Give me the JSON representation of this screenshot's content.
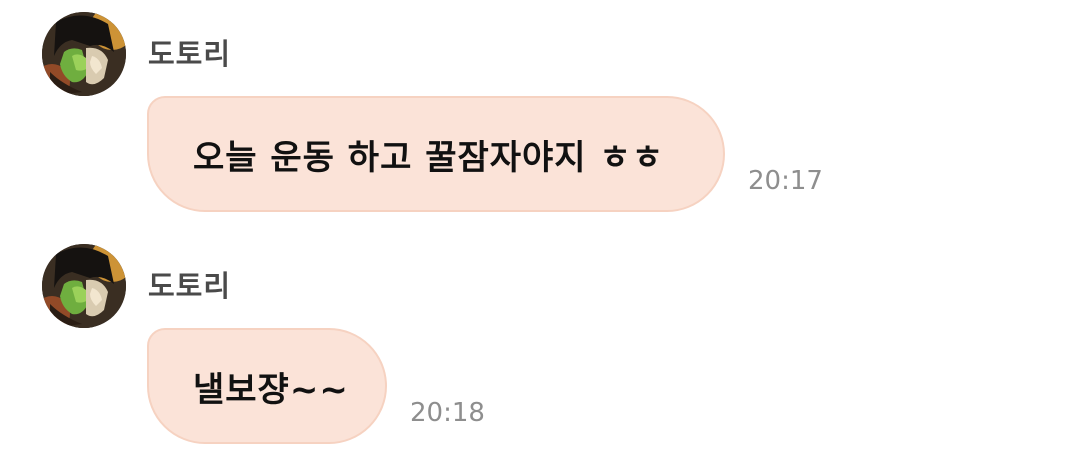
{
  "messages": [
    {
      "sender": "도토리",
      "text": "오늘 운동 하고 꿀잠자야지 ㅎㅎ",
      "time": "20:17",
      "avatar_icon": "profile-photo"
    },
    {
      "sender": "도토리",
      "text": "낼보쟝~~",
      "time": "20:18",
      "avatar_icon": "profile-photo"
    }
  ],
  "colors": {
    "bubble_bg": "#fbe3d8",
    "bubble_border": "#f6d2c1",
    "sender_text": "#4a4a4a",
    "time_text": "#8e8e8e",
    "message_text": "#111111"
  }
}
